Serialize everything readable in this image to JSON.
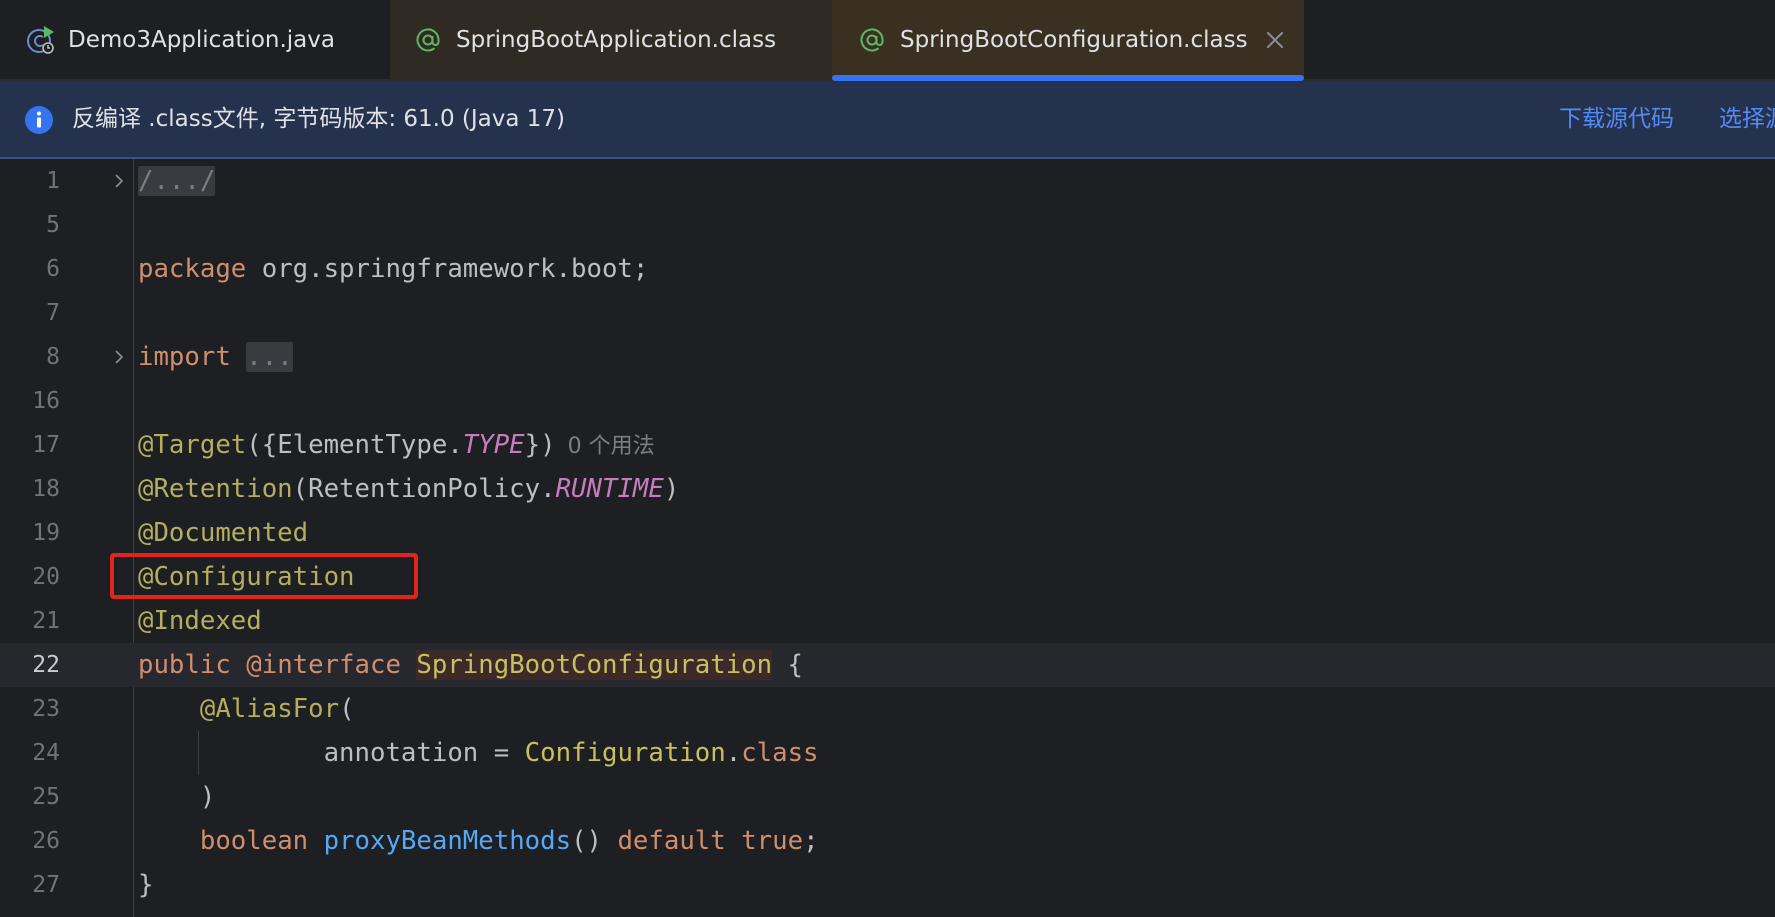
{
  "tabs": [
    {
      "label": "Demo3Application.java",
      "icon": "java-run-class-icon",
      "active": false
    },
    {
      "label": "SpringBootApplication.class",
      "icon": "annotation-icon",
      "active": false
    },
    {
      "label": "SpringBootConfiguration.class",
      "icon": "annotation-icon",
      "active": true
    }
  ],
  "banner": {
    "text": "反编译 .class文件, 字节码版本: 61.0 (Java 17)",
    "download_link": "下载源代码",
    "select_link": "选择源"
  },
  "code": {
    "lines": [
      {
        "num": "1",
        "header": "/.../"
      },
      {
        "num": "5"
      },
      {
        "num": "6",
        "package_kw": "package",
        "package_name": " org.springframework.boot;"
      },
      {
        "num": "7"
      },
      {
        "num": "8",
        "import_kw": "import",
        "import_folded": "..."
      },
      {
        "num": "16"
      },
      {
        "num": "17",
        "ann": "@Target",
        "open": "({ElementType.",
        "enum": "TYPE",
        "close": "})",
        "usages": "0 个用法"
      },
      {
        "num": "18",
        "ann": "@Retention",
        "open": "(RetentionPolicy.",
        "enum": "RUNTIME",
        "close": ")"
      },
      {
        "num": "19",
        "ann": "@Documented"
      },
      {
        "num": "20",
        "ann": "@Configuration"
      },
      {
        "num": "21",
        "ann": "@Indexed"
      },
      {
        "num": "22",
        "public_kw": "public",
        "interface_kw": "@interface",
        "type_name": "SpringBootConfiguration",
        "brace": " {"
      },
      {
        "num": "23",
        "ann": "@AliasFor",
        "open": "("
      },
      {
        "num": "24",
        "param": "annotation = ",
        "cls": "Configuration",
        "dot": ".",
        "class_kw": "class"
      },
      {
        "num": "25",
        "close": ")"
      },
      {
        "num": "26",
        "type_kw": "boolean",
        "method": "proxyBeanMethods",
        "parens": "() ",
        "default_kw": "default",
        "true_kw": "true",
        "semi": ";"
      },
      {
        "num": "27",
        "close": "}"
      }
    ]
  },
  "colors": {
    "accent": "#3574f0",
    "highlight_box": "#e3241c",
    "keyword": "#cf8e6d",
    "annotation": "#b3ae60",
    "method": "#56a8f5"
  }
}
